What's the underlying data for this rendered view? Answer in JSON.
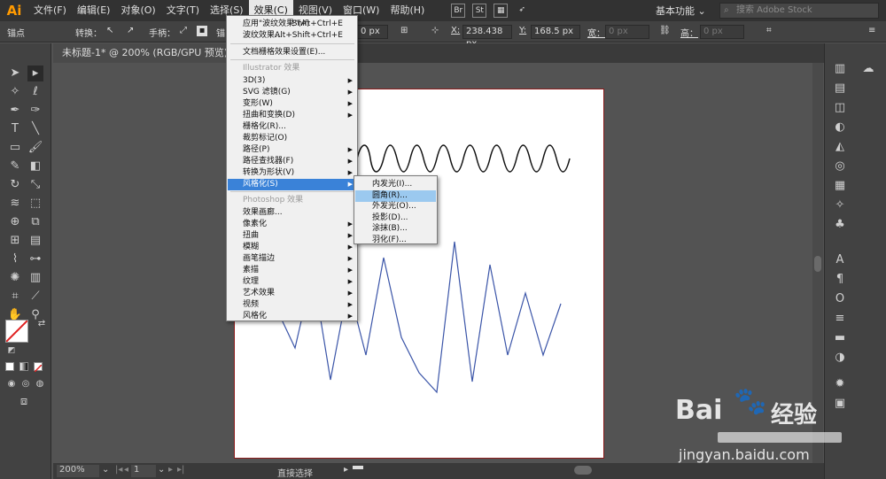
{
  "app": {
    "logo": "Ai"
  },
  "menubar": {
    "items": [
      "文件(F)",
      "编辑(E)",
      "对象(O)",
      "文字(T)",
      "选择(S)",
      "效果(C)",
      "视图(V)",
      "窗口(W)",
      "帮助(H)"
    ],
    "active": "效果(C)",
    "icons": [
      "Br",
      "St"
    ],
    "workspace": "基本功能",
    "search_placeholder": "搜索 Adobe Stock"
  },
  "controlbar": {
    "anchor_label": "锚点",
    "convert_label": "转换：",
    "handle_label": "手柄：",
    "anchor_short": "锚",
    "field_px": "0 px",
    "x_label": "X:",
    "x_value": "238.438 px",
    "y_label": "Y:",
    "y_value": "168.5 px",
    "w_label": "宽：",
    "w_value": "0 px",
    "h_label": "高：",
    "h_value": "0 px"
  },
  "document": {
    "tab_title": "未标题-1* @ 200% (RGB/GPU 预览)",
    "close": "×"
  },
  "status": {
    "zoom": "200%",
    "page": "1",
    "tool": "直接选择"
  },
  "effect_menu": {
    "items": [
      {
        "label": "应用\"波纹效果\"(A)",
        "shortcut": "Shift+Ctrl+E"
      },
      {
        "label": "波纹效果...",
        "shortcut": "Alt+Shift+Ctrl+E"
      },
      {
        "label": "文档栅格效果设置(E)..."
      },
      {
        "label": "Illustrator 效果",
        "header": true
      },
      {
        "label": "3D(3)",
        "submenu": true
      },
      {
        "label": "SVG 滤镜(G)",
        "submenu": true
      },
      {
        "label": "变形(W)",
        "submenu": true
      },
      {
        "label": "扭曲和变换(D)",
        "submenu": true
      },
      {
        "label": "栅格化(R)..."
      },
      {
        "label": "裁剪标记(O)"
      },
      {
        "label": "路径(P)",
        "submenu": true
      },
      {
        "label": "路径查找器(F)",
        "submenu": true
      },
      {
        "label": "转换为形状(V)",
        "submenu": true
      },
      {
        "label": "风格化(S)",
        "submenu": true,
        "highlighted": true
      },
      {
        "label": "Photoshop 效果",
        "header": true
      },
      {
        "label": "效果画廊..."
      },
      {
        "label": "像素化",
        "submenu": true
      },
      {
        "label": "扭曲",
        "submenu": true
      },
      {
        "label": "模糊",
        "submenu": true
      },
      {
        "label": "画笔描边",
        "submenu": true
      },
      {
        "label": "素描",
        "submenu": true
      },
      {
        "label": "纹理",
        "submenu": true
      },
      {
        "label": "艺术效果",
        "submenu": true
      },
      {
        "label": "视频",
        "submenu": true
      },
      {
        "label": "风格化",
        "submenu": true
      }
    ]
  },
  "stylize_submenu": {
    "items": [
      "内发光(I)...",
      "圆角(R)...",
      "外发光(O)...",
      "投影(D)...",
      "涂抹(B)...",
      "羽化(F)..."
    ],
    "highlighted": "圆角(R)..."
  },
  "colors": {
    "menubar_bg": "#323232",
    "panel_bg": "#424242",
    "workspace_bg": "#535353",
    "menu_highlight": "#3a82d8",
    "submenu_highlight": "#9bc9ef",
    "artboard_border": "#8b1a1a",
    "zigzag_stroke": "#3b55a8",
    "wave_stroke": "#000000"
  },
  "watermark": {
    "brand": "Bai",
    "brand2": "经验",
    "url": "jingyan.baidu.com"
  }
}
